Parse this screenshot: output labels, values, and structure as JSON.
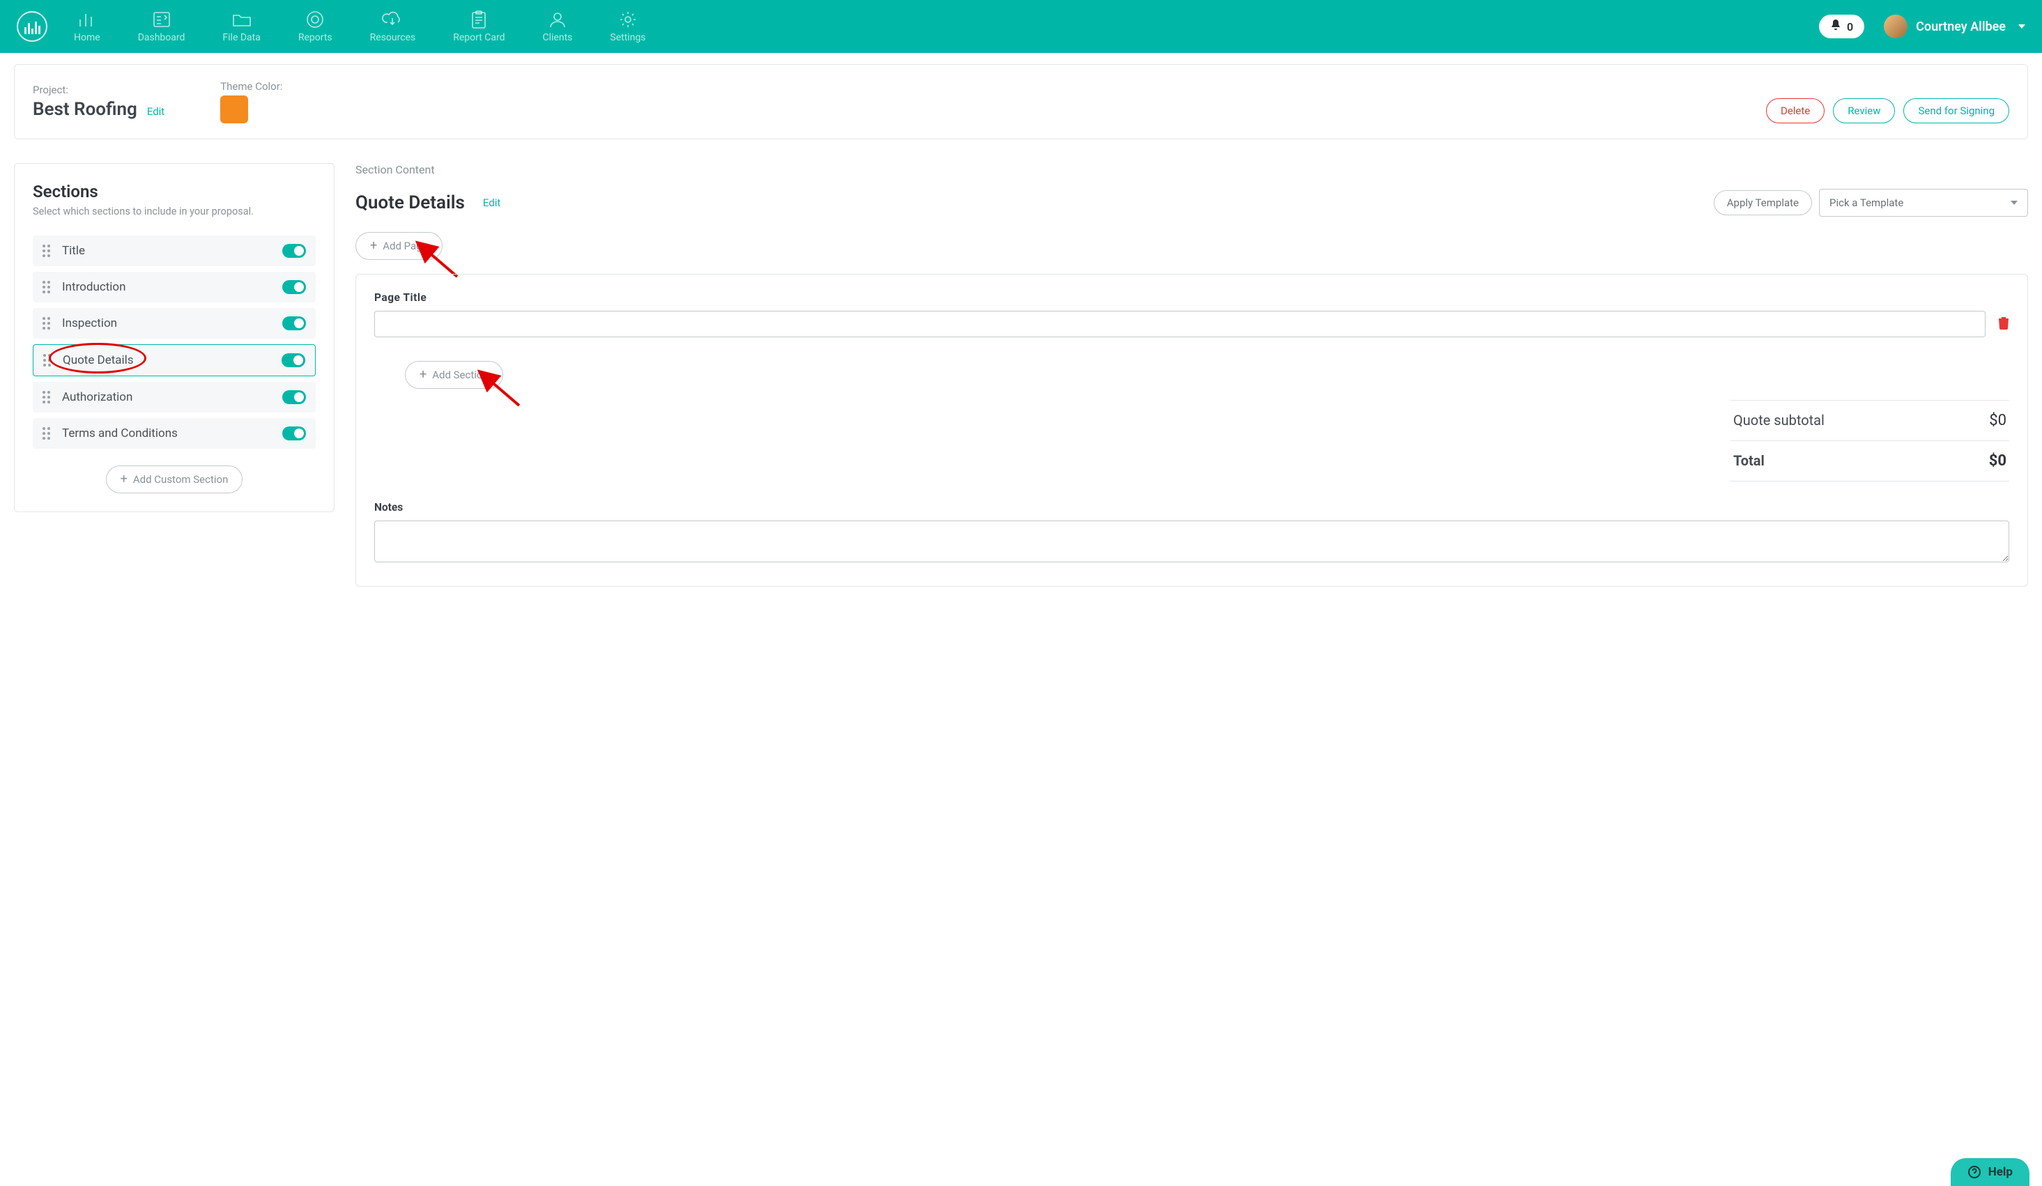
{
  "nav": {
    "items": [
      {
        "label": "Home"
      },
      {
        "label": "Dashboard"
      },
      {
        "label": "File Data"
      },
      {
        "label": "Reports"
      },
      {
        "label": "Resources"
      },
      {
        "label": "Report Card"
      },
      {
        "label": "Clients"
      },
      {
        "label": "Settings"
      }
    ],
    "notifications_count": "0",
    "user_name": "Courtney Allbee"
  },
  "project": {
    "label": "Project:",
    "name": "Best Roofing",
    "edit": "Edit",
    "theme_label": "Theme Color:",
    "theme_color": "#f58a1f",
    "actions": {
      "delete": "Delete",
      "review": "Review",
      "send": "Send for Signing"
    }
  },
  "sections_panel": {
    "title": "Sections",
    "hint": "Select which sections to include in your proposal.",
    "items": [
      {
        "label": "Title"
      },
      {
        "label": "Introduction"
      },
      {
        "label": "Inspection"
      },
      {
        "label": "Quote Details"
      },
      {
        "label": "Authorization"
      },
      {
        "label": "Terms and Conditions"
      }
    ],
    "add_custom": "Add Custom Section"
  },
  "content": {
    "heading": "Section Content",
    "title": "Quote Details",
    "edit": "Edit",
    "apply_template": "Apply Template",
    "template_placeholder": "Pick a Template",
    "add_page": "Add Page",
    "page_title_label": "Page Title",
    "add_section": "Add Section",
    "subtotal_label": "Quote subtotal",
    "subtotal_value": "$0",
    "total_label": "Total",
    "total_value": "$0",
    "notes_label": "Notes"
  },
  "help": {
    "label": "Help"
  }
}
